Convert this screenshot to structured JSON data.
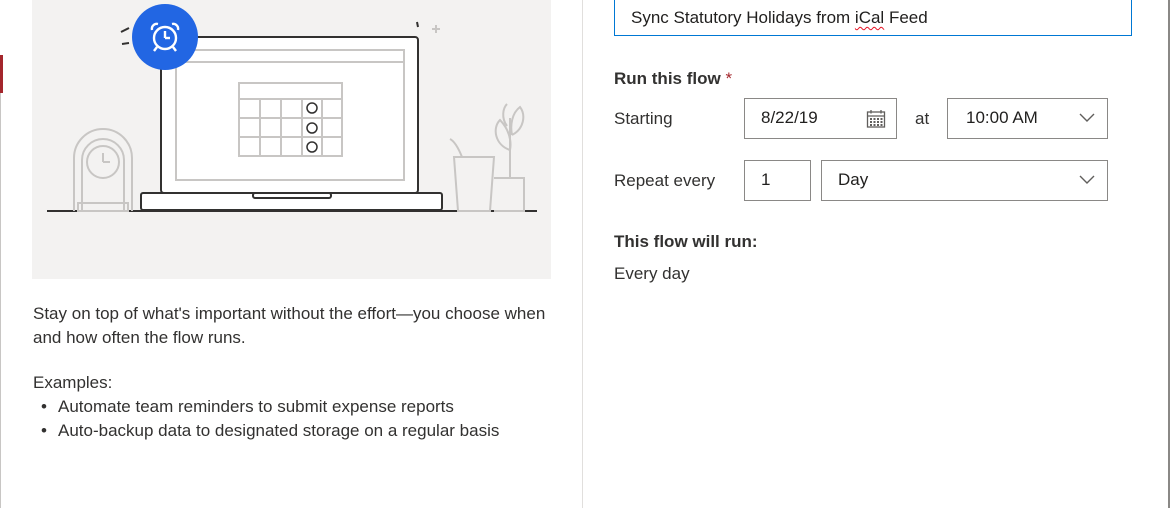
{
  "illustration": {
    "alt_icon": "alarm-clock-icon",
    "accent_color": "#2266e3",
    "line_color": "#323130",
    "soft_line_color": "#c8c6c4",
    "background": "#f3f2f1"
  },
  "description": "Stay on top of what's important without the effort—you choose when and how often the flow runs.",
  "examples": {
    "title": "Examples:",
    "items": [
      "Automate team reminders to submit expense reports",
      "Auto-backup data to designated storage on a regular basis"
    ]
  },
  "flow_name": {
    "prefix": "Sync Statutory Holidays from ",
    "misspelled": "iCal",
    "suffix": " Feed"
  },
  "run": {
    "label": "Run this flow",
    "required_marker": "*",
    "starting_label": "Starting",
    "date": "8/22/19",
    "date_icon": "calendar-icon",
    "at_label": "at",
    "time": "10:00 AM",
    "repeat_label": "Repeat every",
    "interval": "1",
    "frequency": "Day"
  },
  "summary": {
    "label": "This flow will run:",
    "text": "Every day"
  },
  "colors": {
    "focus_border": "#0078d4",
    "required": "#a4262c",
    "spellcheck": "#e81123"
  }
}
